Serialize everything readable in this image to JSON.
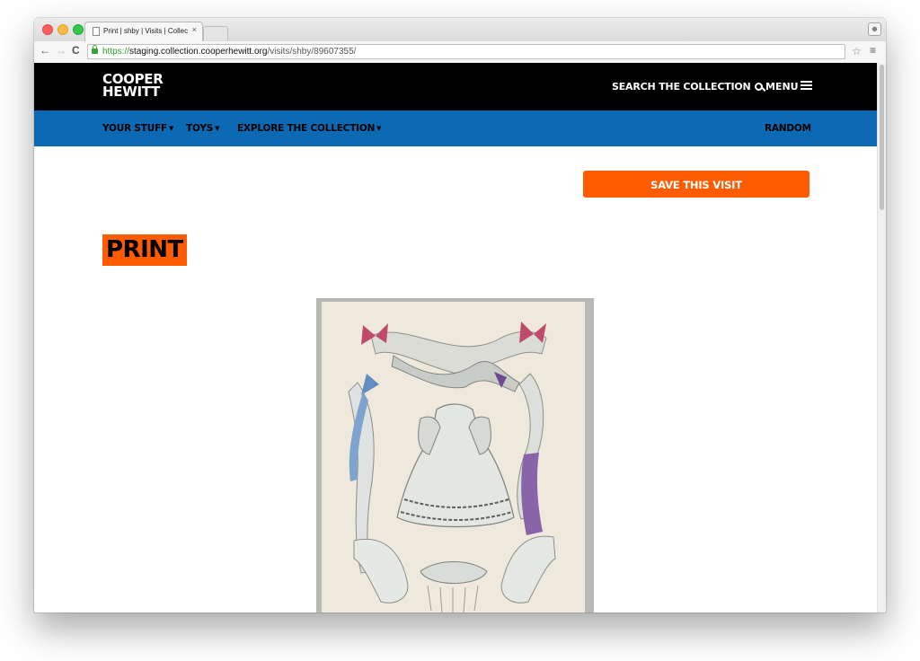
{
  "browser": {
    "tab_title": "Print | shby | Visits | Collec",
    "tab_close": "×",
    "url_scheme": "https://",
    "url_host": "staging.collection.cooperhewitt.org",
    "url_path": "/visits/shby/89607355/"
  },
  "site": {
    "logo_line1": "COOPER",
    "logo_line2": "HEWITT",
    "search_label": "SEARCH THE COLLECTION",
    "menu_label": "MENU"
  },
  "subnav": {
    "your_stuff": "YOUR STUFF",
    "toys": "TOYS",
    "explore": "EXPLORE THE COLLECTION",
    "random": "RANDOM"
  },
  "page": {
    "save_button": "SAVE THIS VISIT",
    "title": "PRINT"
  },
  "colors": {
    "header_bg": "#000000",
    "subnav_bg": "#0c6ab5",
    "accent_orange": "#ff5b00"
  },
  "icons": {
    "search": "search-icon",
    "menu": "hamburger-icon",
    "secure": "lock-icon"
  }
}
